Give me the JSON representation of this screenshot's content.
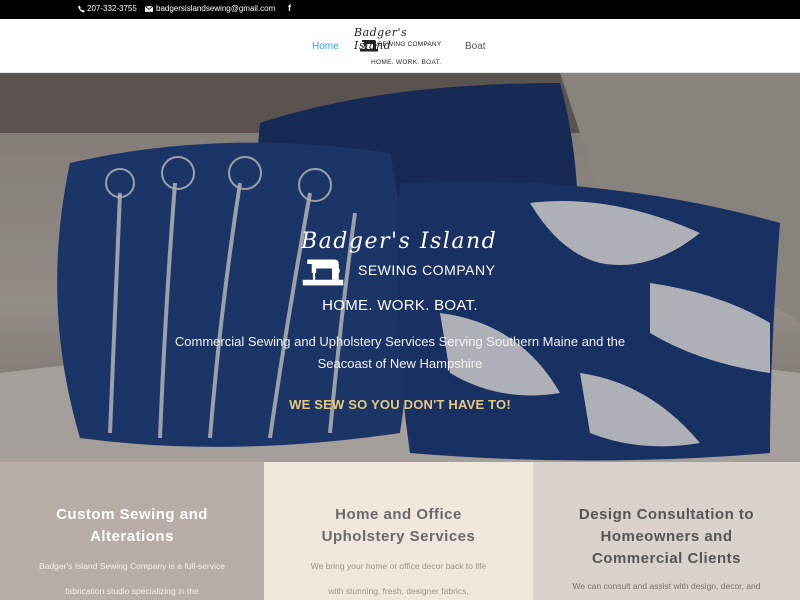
{
  "topbar": {
    "phone": "207-332-3755",
    "email": "badgersislandsewing@gmail.com",
    "facebook_glyph": "f",
    "icons": [
      "phone-icon",
      "mail-icon",
      "facebook-icon"
    ]
  },
  "nav": {
    "items": [
      {
        "label": "Home",
        "active": true
      },
      {
        "label": "Boat",
        "active": false
      }
    ],
    "active_color": "#2ea3f2"
  },
  "logo": {
    "script": "Badger's Island",
    "company": "SEWING COMPANY",
    "tagline": "HOME. WORK. BOAT."
  },
  "hero": {
    "logo_script": "Badger's Island",
    "logo_company": "SEWING COMPANY",
    "tagline": "HOME. WORK. BOAT.",
    "description": "Commercial Sewing and Upholstery Services Serving Southern Maine and the Seacoast of New Hampshire",
    "cta": "WE SEW SO YOU DON'T HAVE TO!",
    "cta_color": "#e6c97f"
  },
  "features": [
    {
      "title": "Custom Sewing and Alterations",
      "text": "Badger's Island Sewing Company is a full-service fabrication studio specializing in the",
      "bg": "#b8aca6"
    },
    {
      "title": "Home and Office Upholstery Services",
      "text": "We bring your home or office decor back to life with stunning, fresh, designer fabrics,",
      "bg": "#efe6dc"
    },
    {
      "title": "Design Consultation to Homeowners and Commercial Clients",
      "text": "We can consult and assist with design, decor, and planning of beautiful new design",
      "bg": "#d9d1cb"
    }
  ]
}
